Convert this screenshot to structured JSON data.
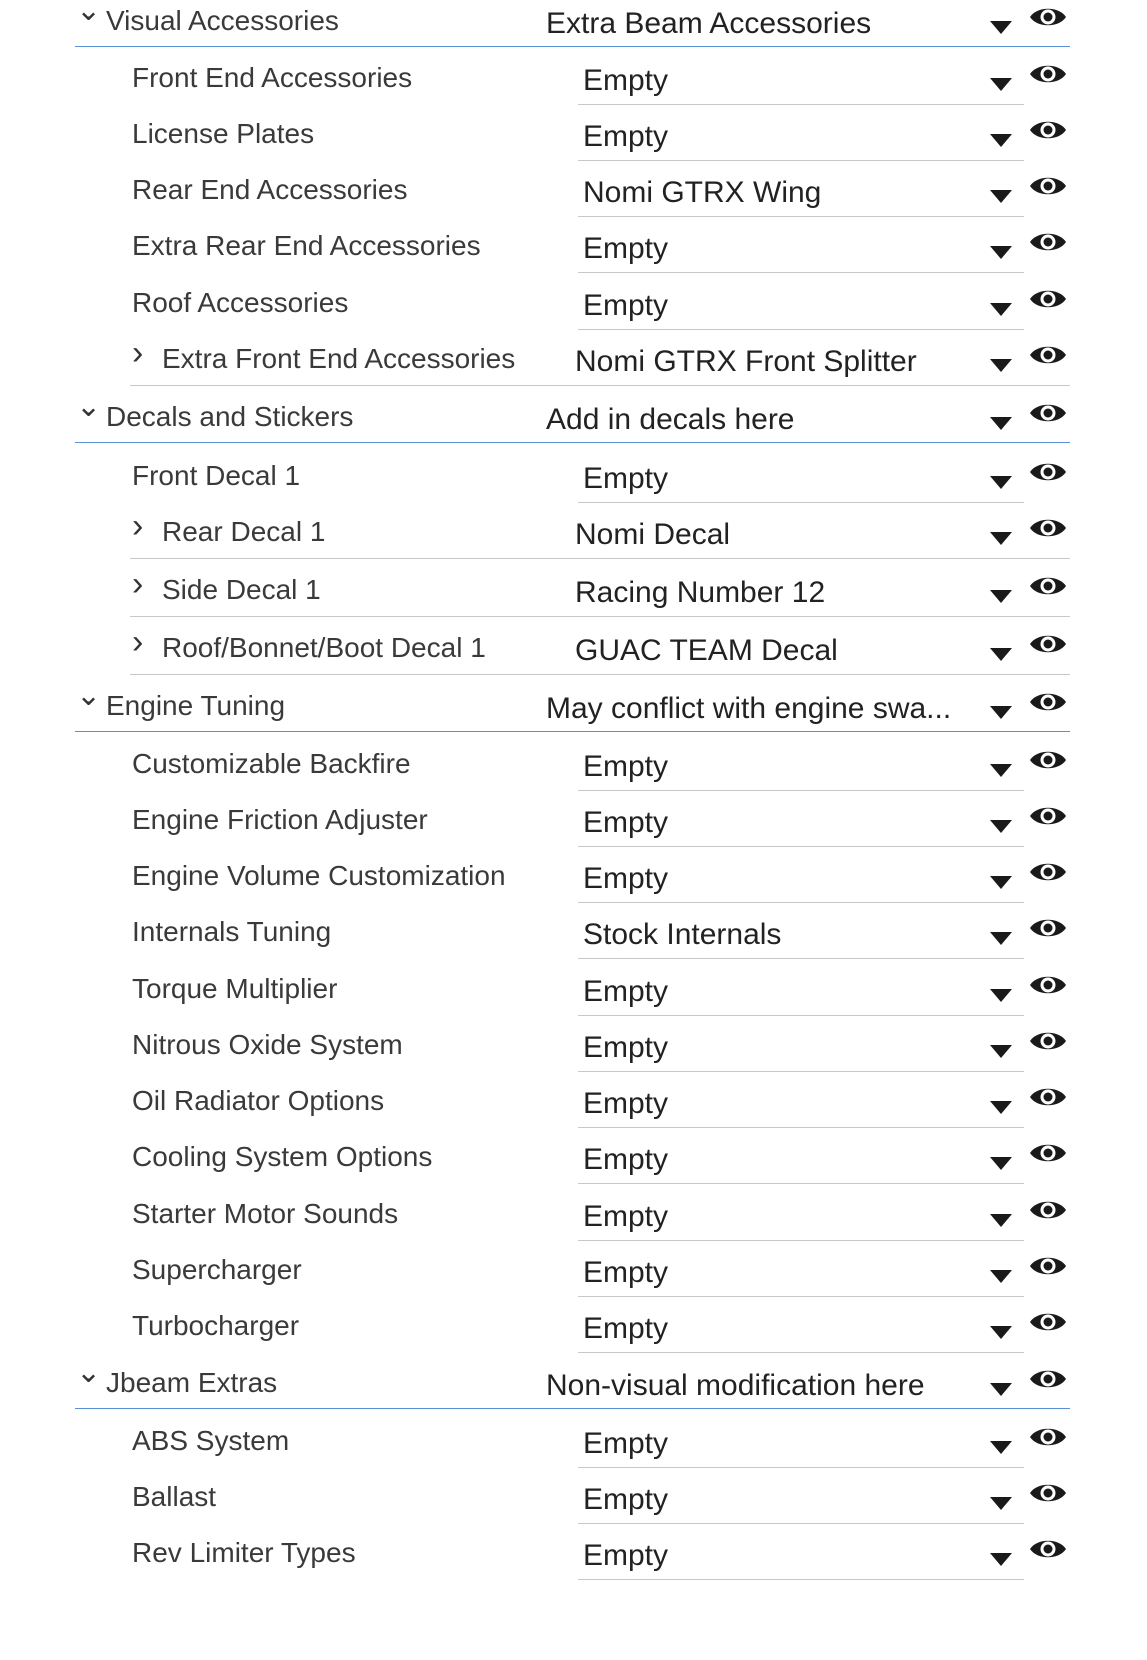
{
  "rows": [
    {
      "label": "Visual Accessories",
      "value": "Extra Beam Accessories",
      "kind": "group"
    },
    {
      "label": "Front End Accessories",
      "value": "Empty",
      "kind": "item"
    },
    {
      "label": "License Plates",
      "value": "Empty",
      "kind": "item"
    },
    {
      "label": "Rear End Accessories",
      "value": "Nomi GTRX Wing",
      "kind": "item"
    },
    {
      "label": "Extra Rear End Accessories",
      "value": "Empty",
      "kind": "item"
    },
    {
      "label": "Roof Accessories",
      "value": "Empty",
      "kind": "item"
    },
    {
      "label": "Extra Front End Accessories",
      "value": "Nomi GTRX Front Splitter",
      "kind": "sub"
    },
    {
      "label": "Decals and Stickers",
      "value": "Add in decals here",
      "kind": "group"
    },
    {
      "label": "Front Decal 1",
      "value": "Empty",
      "kind": "item"
    },
    {
      "label": "Rear Decal 1",
      "value": "Nomi Decal",
      "kind": "sub"
    },
    {
      "label": "Side Decal 1",
      "value": "Racing Number 12",
      "kind": "sub"
    },
    {
      "label": "Roof/Bonnet/Boot Decal 1",
      "value": "GUAC TEAM Decal",
      "kind": "sub"
    },
    {
      "label": "Engine Tuning",
      "value": "May conflict with engine swa...",
      "kind": "group"
    },
    {
      "label": "Customizable Backfire",
      "value": "Empty",
      "kind": "item"
    },
    {
      "label": "Engine Friction Adjuster",
      "value": "Empty",
      "kind": "item"
    },
    {
      "label": "Engine Volume Customization",
      "value": "Empty",
      "kind": "item"
    },
    {
      "label": "Internals Tuning",
      "value": "Stock Internals",
      "kind": "item"
    },
    {
      "label": "Torque Multiplier",
      "value": "Empty",
      "kind": "item"
    },
    {
      "label": "Nitrous Oxide System",
      "value": "Empty",
      "kind": "item"
    },
    {
      "label": "Oil Radiator Options",
      "value": "Empty",
      "kind": "item"
    },
    {
      "label": "Cooling System Options",
      "value": "Empty",
      "kind": "item"
    },
    {
      "label": "Starter Motor Sounds",
      "value": "Empty",
      "kind": "item"
    },
    {
      "label": "Supercharger",
      "value": "Empty",
      "kind": "item"
    },
    {
      "label": "Turbocharger",
      "value": "Empty",
      "kind": "item"
    },
    {
      "label": "Jbeam Extras",
      "value": "Non-visual modification here",
      "kind": "group"
    },
    {
      "label": "ABS System",
      "value": "Empty",
      "kind": "item"
    },
    {
      "label": "Ballast",
      "value": "Empty",
      "kind": "item"
    },
    {
      "label": "Rev Limiter Types",
      "value": "Empty",
      "kind": "item"
    }
  ],
  "icons": {
    "expanded": "chevron-down-icon",
    "collapsed": "chevron-right-icon",
    "dropdown": "dropdown-arrow-icon",
    "visibility": "eye-icon"
  },
  "colors": {
    "group_underline": "#5b8fd6",
    "item_underline": "#c8c8c8",
    "eye": "#1a1a1a"
  }
}
